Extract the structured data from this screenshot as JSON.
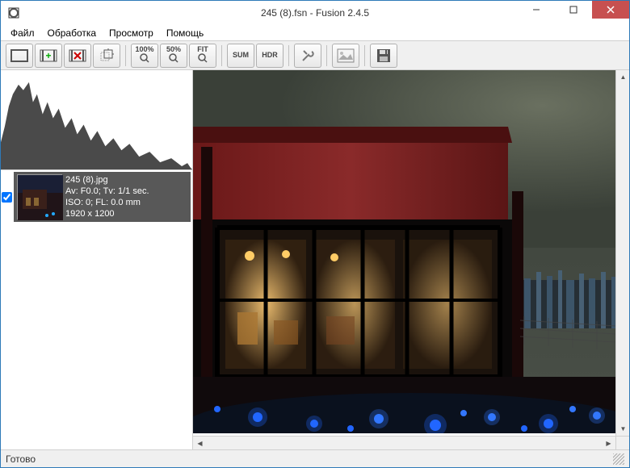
{
  "window": {
    "title": "245 (8).fsn - Fusion 2.4.5"
  },
  "menu": {
    "file": "Файл",
    "process": "Обработка",
    "view": "Просмотр",
    "help": "Помощь"
  },
  "toolbar": {
    "zoom100": "100%",
    "zoom50": "50%",
    "fit": "FIT",
    "sum": "SUM",
    "hdr": "HDR"
  },
  "thumbs": [
    {
      "filename": "245 (8).jpg",
      "exposure": "Av: F0.0; Tv: 1/1 sec.",
      "iso": "ISO: 0; FL: 0.0 mm",
      "dims": "1920 x 1200",
      "checked": true
    }
  ],
  "status": {
    "text": "Готово"
  },
  "icons": {
    "minimize": "min",
    "maximize": "max",
    "close": "close"
  }
}
